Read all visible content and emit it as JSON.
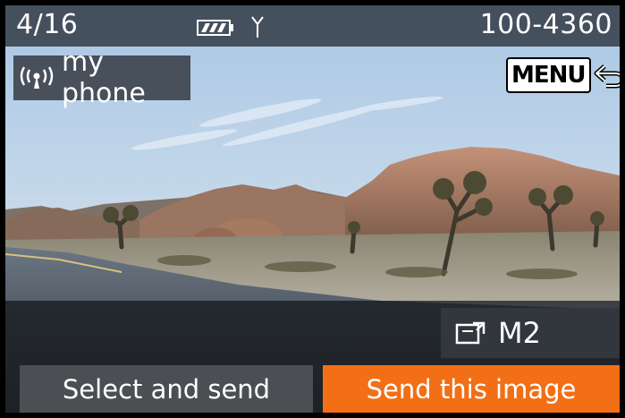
{
  "status_bar": {
    "frame_counter": "4/16",
    "file_number": "100-4360",
    "battery_icon": "battery-icon",
    "antenna_icon": "antenna-icon"
  },
  "connection": {
    "device_name": "my phone",
    "icon": "wifi-signal-icon"
  },
  "menu": {
    "key_label": "MENU",
    "icon": "return-arrow-icon"
  },
  "image_size": {
    "label": "M2",
    "icon": "resize-icon"
  },
  "actions": {
    "select_label": "Select and send",
    "send_label": "Send this image"
  },
  "colors": {
    "send_button": "#f26f16",
    "select_button": "#4b4e52",
    "status_bar": "#282e38"
  }
}
